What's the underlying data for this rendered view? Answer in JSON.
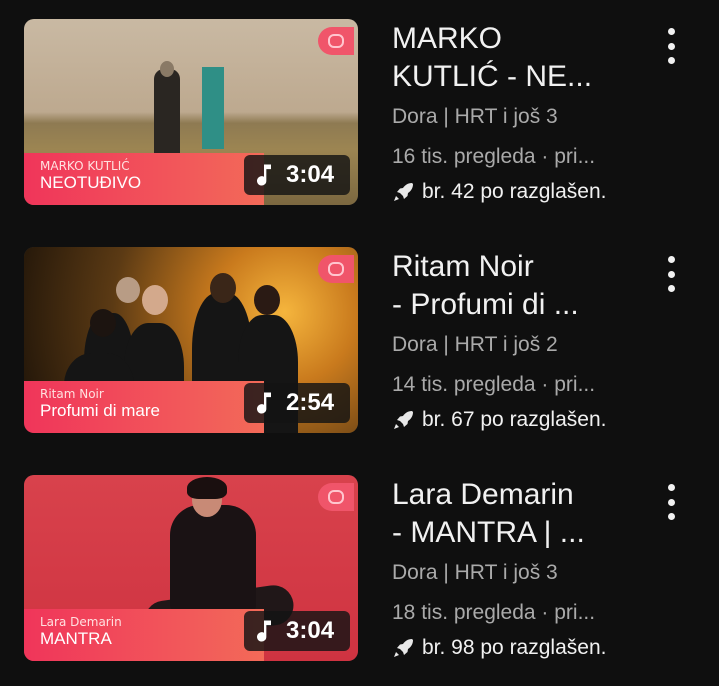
{
  "videos": [
    {
      "title_line1": "MARKO",
      "title_line2": "KUTLIĆ - NE...",
      "channel": "Dora | HRT i još 3",
      "stats": "16 tis. pregleda · pri...",
      "rank": "br. 42 po razglašen.",
      "thumb_artist": "MARKO KUTLIĆ",
      "thumb_song": "NEOTUĐIVO",
      "duration": "3:04"
    },
    {
      "title_line1": "Ritam Noir",
      "title_line2": "- Profumi di ...",
      "channel": "Dora | HRT i još 2",
      "stats": "14 tis. pregleda · pri...",
      "rank": "br. 67 po razglašen.",
      "thumb_artist": "Ritam Noir",
      "thumb_song": "Profumi di mare",
      "duration": "2:54"
    },
    {
      "title_line1": "Lara Demarin",
      "title_line2": "- MANTRA | ...",
      "channel": "Dora | HRT i još 3",
      "stats": "18 tis. pregleda · pri...",
      "rank": "br. 98 po razglašen.",
      "thumb_artist": "Lara Demarin",
      "thumb_song": "MANTRA",
      "duration": "3:04"
    }
  ],
  "icons": {
    "duration": "music-note-icon",
    "rank": "trending-rocket-icon",
    "menu": "more-vert-icon",
    "badge": "channel-logo-icon"
  },
  "colors": {
    "background": "#0f0f0f",
    "caption_pink": "#f0355a",
    "secondary_text": "#aaaaaa"
  }
}
